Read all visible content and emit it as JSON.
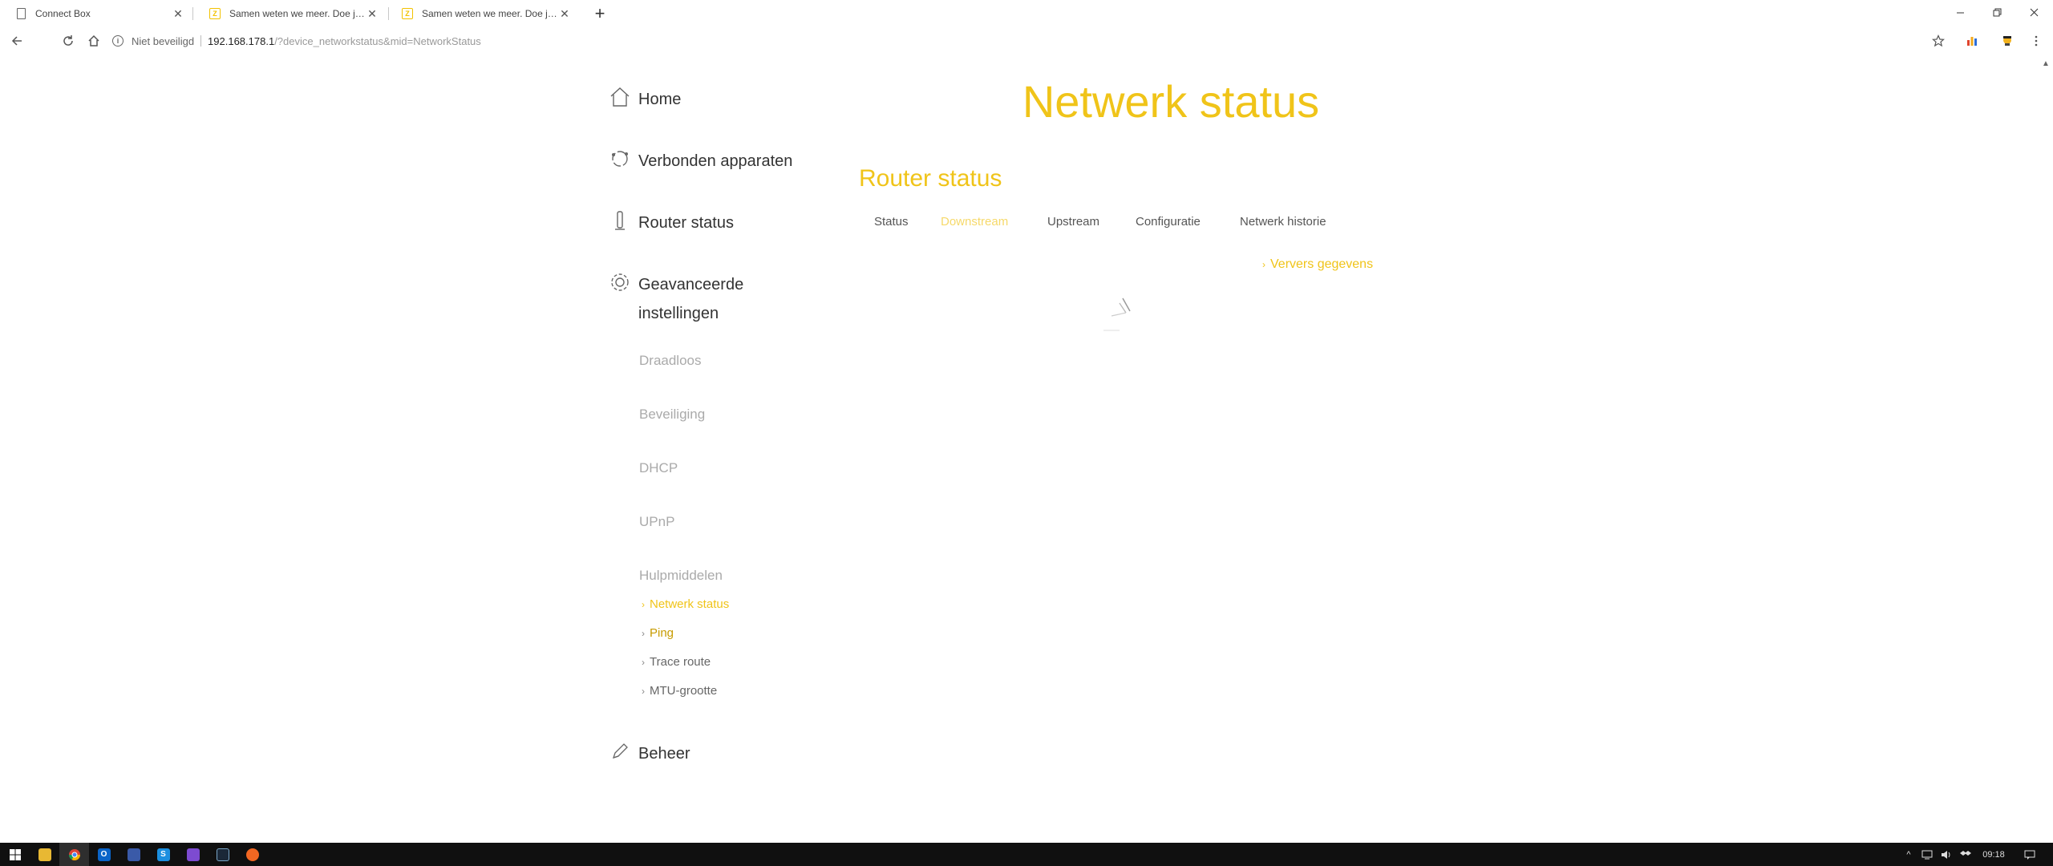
{
  "browser": {
    "tabs": [
      {
        "title": "Connect Box",
        "icon": "page-icon"
      },
      {
        "title": "Samen weten we meer. Doe je m",
        "icon": "ziggo-icon"
      },
      {
        "title": "Samen weten we meer. Doe je m",
        "icon": "ziggo-icon"
      }
    ],
    "new_tab_symbol": "+",
    "address": {
      "security_label": "Niet beveiligd",
      "host": "192.168.178.1",
      "path": "/?device_networkstatus&mid=NetworkStatus"
    }
  },
  "sidebar": {
    "main_items": [
      {
        "label": "Home",
        "icon": "home-icon"
      },
      {
        "label": "Verbonden apparaten",
        "icon": "devices-icon"
      },
      {
        "label": "Router status",
        "icon": "router-icon"
      },
      {
        "label": "Geavanceerde instellingen",
        "line1": "Geavanceerde",
        "line2": "instellingen",
        "icon": "gear-icon"
      },
      {
        "label": "Beheer",
        "icon": "pencil-icon"
      }
    ],
    "advanced_items": [
      "Draadloos",
      "Beveiliging",
      "DHCP",
      "UPnP",
      "Hulpmiddelen"
    ],
    "tools_items": [
      {
        "label": "Netwerk status",
        "active": true
      },
      {
        "label": "Ping",
        "active": false
      },
      {
        "label": "Trace route",
        "active": false
      },
      {
        "label": "MTU-grootte",
        "active": false
      }
    ]
  },
  "main": {
    "page_title": "Netwerk status",
    "section_title": "Router status",
    "tabs": [
      {
        "label": "Status",
        "active": false
      },
      {
        "label": "Downstream",
        "active": true
      },
      {
        "label": "Upstream",
        "active": false
      },
      {
        "label": "Configuratie",
        "active": false
      },
      {
        "label": "Netwerk historie",
        "active": false
      }
    ],
    "refresh_label": "Ververs gegevens"
  },
  "taskbar": {
    "clock": "09:18"
  },
  "colors": {
    "accent": "#f0c419",
    "accent_light": "#f6d96a",
    "text": "#333333",
    "muted": "#aaaaaa"
  }
}
